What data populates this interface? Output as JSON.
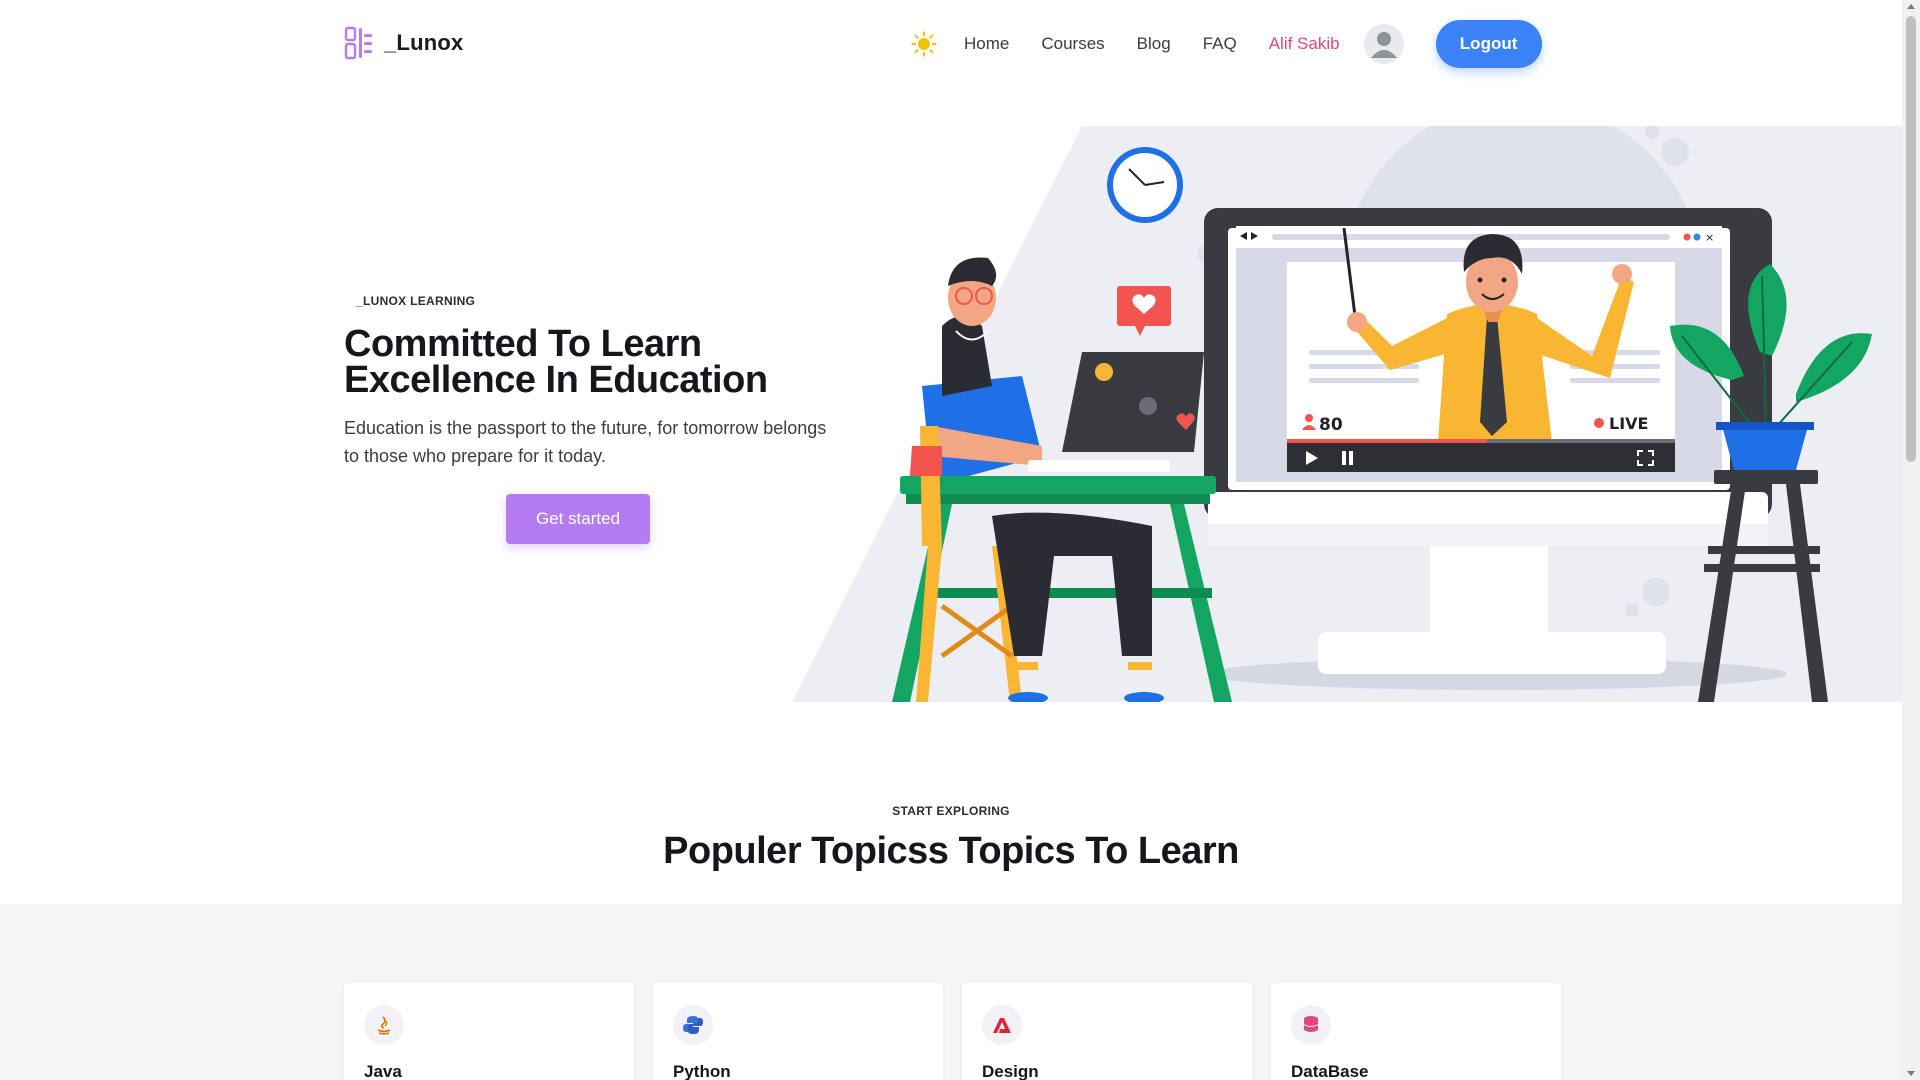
{
  "brand": {
    "name": "_Lunox"
  },
  "nav": {
    "links": [
      "Home",
      "Courses",
      "Blog",
      "FAQ"
    ],
    "user_name": "Alif Sakib",
    "logout_label": "Logout"
  },
  "hero": {
    "eyebrow": "_LUNOX LEARNING",
    "title_line1": "Committed To Learn",
    "title_line2": "Excellence In Education",
    "subtitle": "Education is the passport to the future, for tomorrow belongs to those who prepare for it today.",
    "cta_label": "Get started",
    "video": {
      "viewers": "80",
      "live_label": "LIVE"
    }
  },
  "topics_section": {
    "eyebrow": "START EXPLORING",
    "title": "Populer Topicss Topics To Learn",
    "cards": [
      {
        "name": "Java",
        "icon": "java-icon"
      },
      {
        "name": "Python",
        "icon": "python-icon"
      },
      {
        "name": "Design",
        "icon": "design-icon"
      },
      {
        "name": "DataBase",
        "icon": "database-icon"
      }
    ]
  },
  "colors": {
    "accent_blue": "#3b82f6",
    "cta_purple": "#b57bf2",
    "user_pink": "#e0487f",
    "brand_logo": "#b57bf2"
  }
}
